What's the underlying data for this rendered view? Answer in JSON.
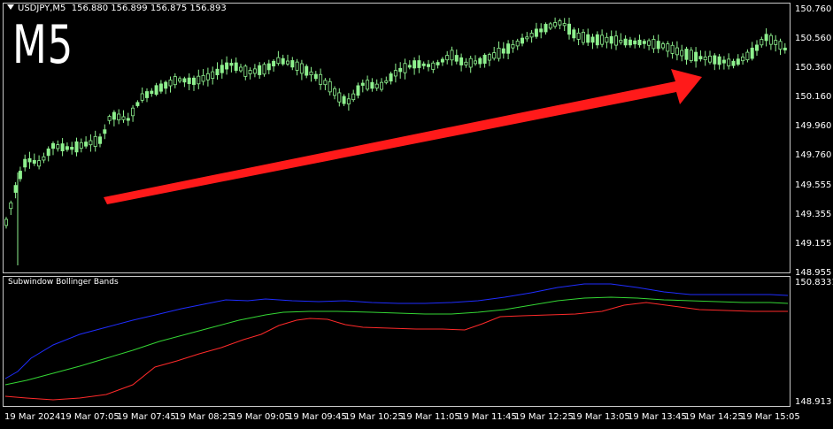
{
  "header": {
    "symbol_line": "USDJPY,M5  156.880 156.899 156.875 156.893",
    "timeframe_overlay": "M5"
  },
  "main_axis": {
    "labels": [
      "150.760",
      "150.560",
      "150.360",
      "150.160",
      "149.960",
      "149.760",
      "149.555",
      "149.355",
      "149.155",
      "148.955"
    ]
  },
  "sub_window": {
    "title": "Subwindow Bollinger Bands",
    "axis_top": "150.8331",
    "axis_bottom": "148.913",
    "colors": {
      "upper": "#1f2dff",
      "middle": "#34d634",
      "lower": "#ff2a2a"
    }
  },
  "time_axis": {
    "labels": [
      "19 Mar 2024",
      "19 Mar 07:05",
      "19 Mar 07:45",
      "19 Mar 08:25",
      "19 Mar 09:05",
      "19 Mar 09:45",
      "19 Mar 10:25",
      "19 Mar 11:05",
      "19 Mar 11:45",
      "19 Mar 12:25",
      "19 Mar 13:05",
      "19 Mar 13:45",
      "19 Mar 14:25",
      "19 Mar 15:05"
    ]
  },
  "annotation": {
    "arrow_color": "#ff1a1a",
    "direction": "up-right"
  },
  "candle_color": "#8ef08e"
}
